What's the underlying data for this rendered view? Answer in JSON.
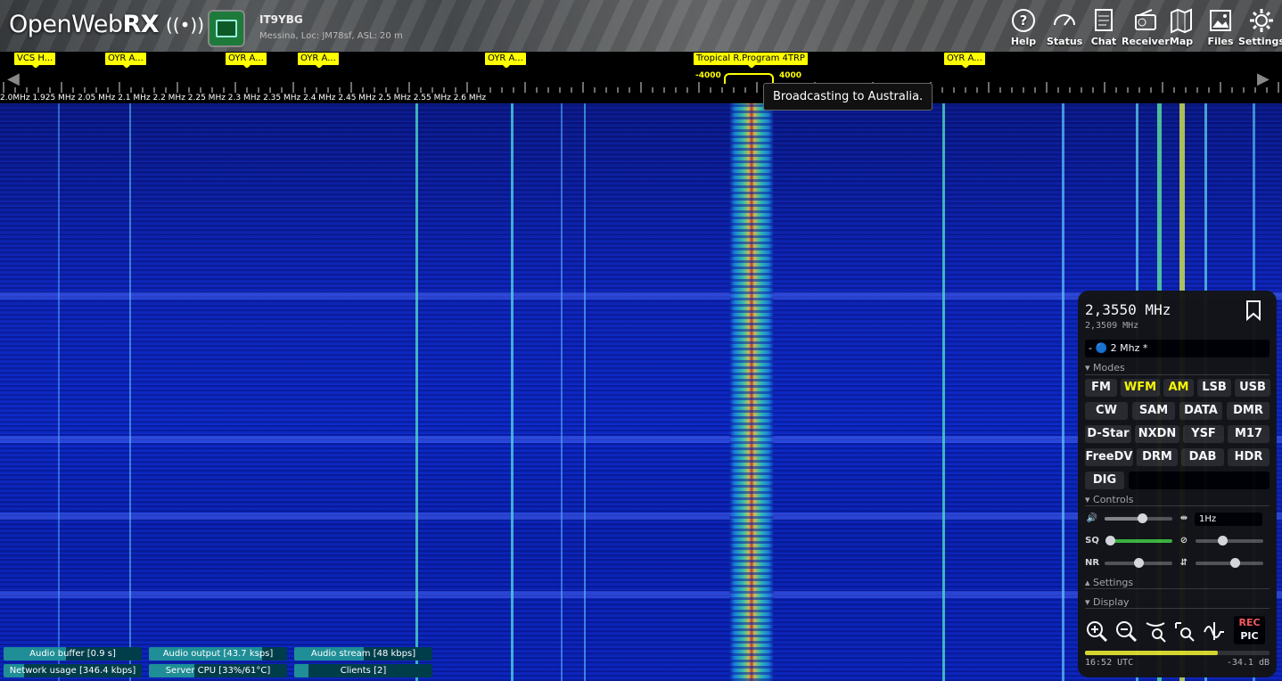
{
  "header": {
    "logo_text": "OpenWeb",
    "logo_bold": "RX",
    "receiver_name": "IT9YBG",
    "receiver_desc": "Messina, Loc: JM78sf, ASL: 20 m",
    "nav": [
      {
        "label": "Help",
        "icon": "help-icon"
      },
      {
        "label": "Status",
        "icon": "gauge-icon"
      },
      {
        "label": "Chat",
        "icon": "chat-icon"
      },
      {
        "label": "Receiver",
        "icon": "radio-icon"
      },
      {
        "label": "Map",
        "icon": "map-icon"
      },
      {
        "label": "Files",
        "icon": "image-icon"
      },
      {
        "label": "Settings",
        "icon": "gear-icon"
      }
    ]
  },
  "bookmarks": [
    "VCS H...",
    "OYR A...",
    "OYR A...",
    "OYR A...",
    "OYR A...",
    "Tropical R.Program 4TRP",
    "OYR A..."
  ],
  "passband": {
    "low": "-4000",
    "high": "4000"
  },
  "scale_text": "2.0MHz  1.925 MHz  2.05 MHz  2.1 MHz  2.2 MHz  2.25 MHz  2.3 MHz  2.35 MHz  2.4 MHz  2.45 MHz  2.5 MHz  2.55 MHz  2.6 MHz",
  "tooltip": "Broadcasting to Australia.",
  "panel": {
    "frequency": "2,3550 MHz",
    "offset_frequency": "2,3509 MHz",
    "profile": "- 🔵 2 Mhz *",
    "modes_heading": "▾ Modes",
    "modes": [
      "FM",
      "WFM",
      "AM",
      "LSB",
      "USB",
      "CW",
      "SAM",
      "DATA",
      "DMR",
      "D-Star",
      "NXDN",
      "YSF",
      "M17",
      "FreeDV",
      "DRM",
      "DAB",
      "HDR",
      "DIG"
    ],
    "active_mode": "AM",
    "controls_heading": "▾ Controls",
    "tuning_step": "1Hz",
    "squelch_label": "SQ",
    "nr_label": "NR",
    "settings_heading": "▴ Settings",
    "display_heading": "▾ Display",
    "rec_label": "REC",
    "pic_label": "PIC",
    "clock": "16:52 UTC",
    "smeter_db": "-34.1 dB",
    "smeter_level": 0.72,
    "volume_level": 0.55,
    "squelch_level": 0.0,
    "nr_level": 0.5
  },
  "status_bars": [
    {
      "label": "Audio buffer [0.9 s]",
      "level": 0.45
    },
    {
      "label": "Audio output [43.7 ksps]",
      "level": 0.82
    },
    {
      "label": "Audio stream [48 kbps]",
      "level": 0.5
    },
    {
      "label": "Network usage [346.4 kbps]",
      "level": 0.15
    },
    {
      "label": "Server CPU [33%/61°C]",
      "level": 0.33
    },
    {
      "label": "Clients [2]",
      "level": 0.1
    }
  ],
  "colors": {
    "bookmark": "#ffff00",
    "waterfall_bg": "#0c28c2",
    "active_mode": "#ffff00",
    "rec": "#ff5b5b",
    "status_fill": "#1f8e96"
  }
}
